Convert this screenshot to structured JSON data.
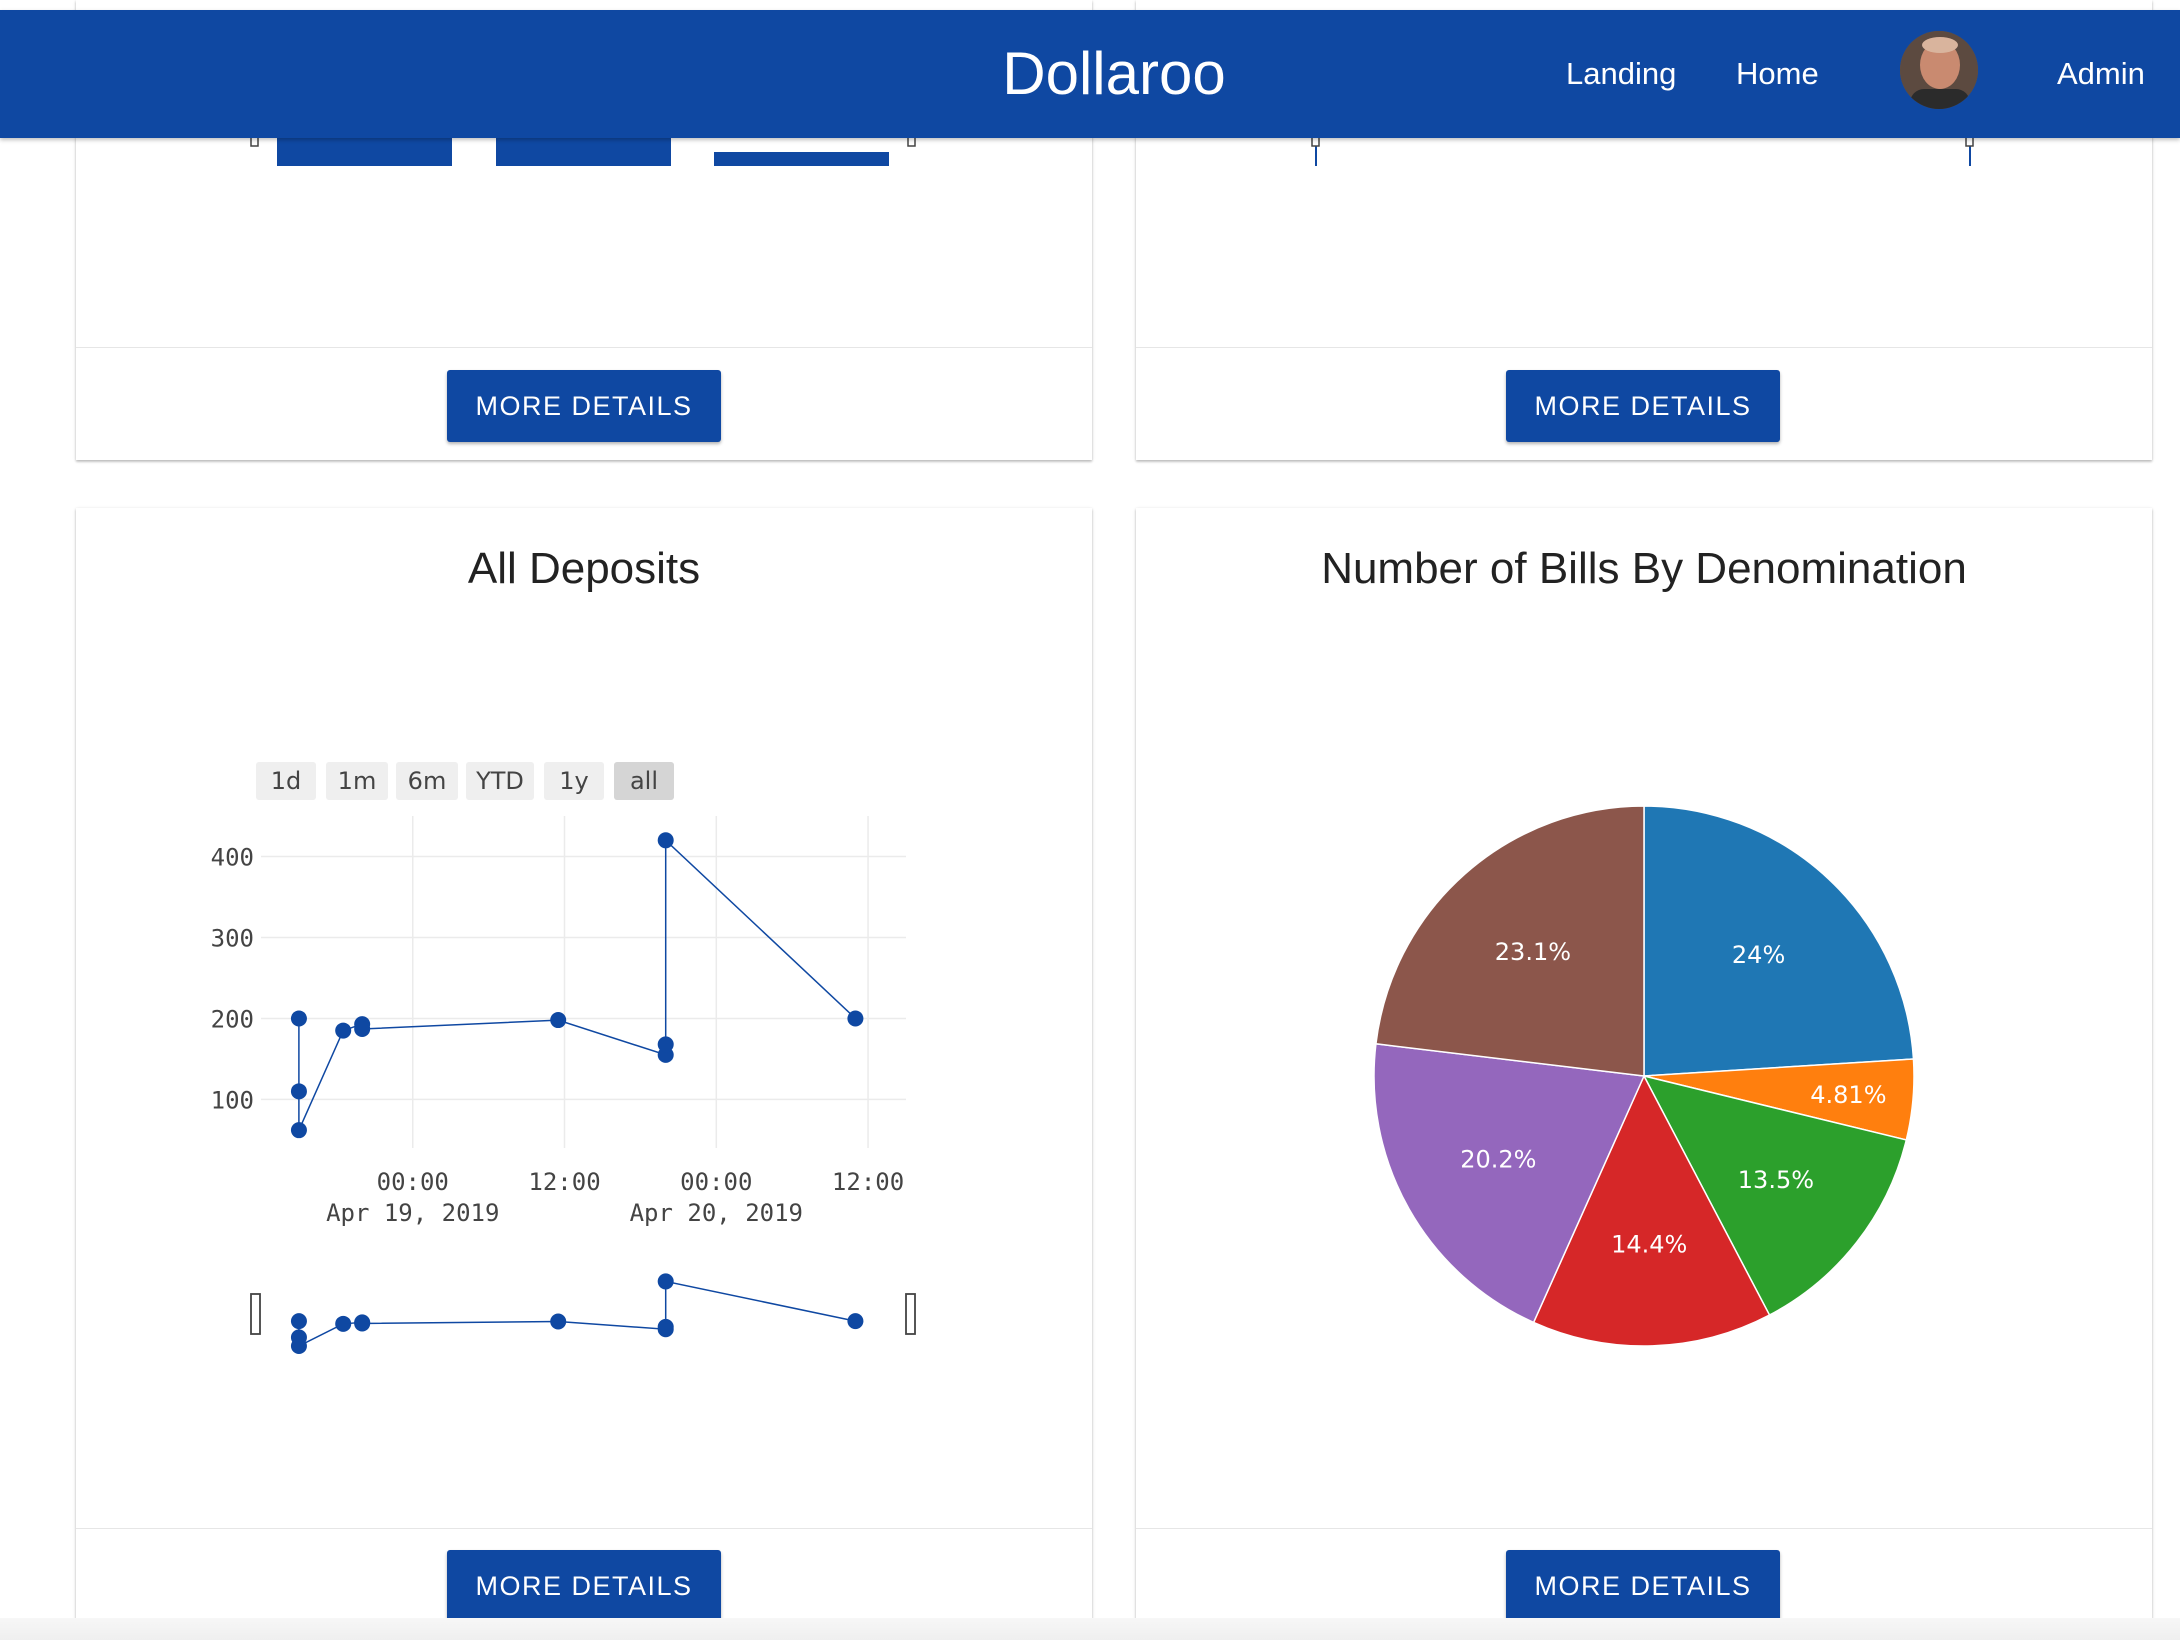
{
  "app": {
    "title": "Dollaroo",
    "nav": {
      "landing": "Landing",
      "home": "Home",
      "admin": "Admin"
    }
  },
  "cards": {
    "top_left": {
      "button_label": "MORE DETAILS"
    },
    "top_right": {
      "button_label": "MORE DETAILS"
    },
    "deposits": {
      "title": "All Deposits",
      "button_label": "MORE DETAILS"
    },
    "bills": {
      "title": "Number of Bills By Denomination",
      "button_label": "MORE DETAILS"
    }
  },
  "range_selector": {
    "buttons": [
      "1d",
      "1m",
      "6m",
      "YTD",
      "1y",
      "all"
    ],
    "active": "all"
  },
  "colors": {
    "primary": "#0f48a2",
    "pie": [
      "#1f77b4",
      "#ff7f0e",
      "#2ca02c",
      "#d62728",
      "#9467bd",
      "#8c564b"
    ]
  },
  "chart_data": [
    {
      "type": "line",
      "title": "All Deposits",
      "x": [
        "2019-04-18 15:00",
        "2019-04-18 15:00",
        "2019-04-18 15:00",
        "2019-04-18 18:30",
        "2019-04-18 20:00",
        "2019-04-18 20:00",
        "2019-04-19 11:30",
        "2019-04-19 20:00",
        "2019-04-19 20:00",
        "2019-04-19 20:00",
        "2019-04-20 11:00"
      ],
      "y": [
        200,
        110,
        62,
        185,
        193,
        187,
        198,
        155,
        168,
        420,
        200
      ],
      "x_tick_labels": [
        [
          "00:00",
          "Apr 19, 2019"
        ],
        [
          "12:00",
          ""
        ],
        [
          "00:00",
          "Apr 20, 2019"
        ],
        [
          "12:00",
          ""
        ]
      ],
      "y_ticks": [
        100,
        200,
        300,
        400
      ],
      "ylim": [
        40,
        450
      ],
      "xlabel": "",
      "ylabel": "",
      "grid": true,
      "range_slider": true,
      "range_selector": [
        "1d",
        "1m",
        "6m",
        "YTD",
        "1y",
        "all"
      ]
    },
    {
      "type": "pie",
      "title": "Number of Bills By Denomination",
      "labels": [
        "24%",
        "4.81%",
        "13.5%",
        "14.4%",
        "20.2%",
        "23.1%"
      ],
      "values": [
        24,
        4.81,
        13.5,
        14.4,
        20.2,
        23.1
      ]
    }
  ]
}
